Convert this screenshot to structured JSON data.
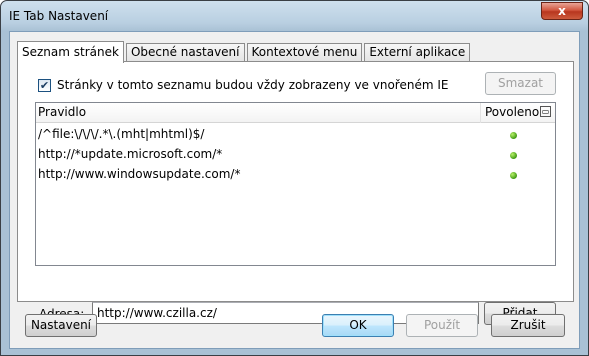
{
  "window": {
    "title": "IE Tab Nastavení",
    "close_glyph": "x"
  },
  "tabs": [
    {
      "label": "Seznam stránek",
      "active": true
    },
    {
      "label": "Obecné nastavení",
      "active": false
    },
    {
      "label": "Kontextové menu",
      "active": false
    },
    {
      "label": "Externí aplikace",
      "active": false
    }
  ],
  "sites_tab": {
    "checkbox": {
      "label": "Stránky v tomto seznamu budou vždy zobrazeny ve vnořeném IE",
      "checked": true,
      "check_glyph": "✔"
    },
    "delete_label": "Smazat",
    "list": {
      "columns": {
        "rule": "Pravidlo",
        "enabled": "Povoleno"
      },
      "column_picker_icon": "column-picker-icon",
      "rows": [
        {
          "pattern": "/^file:\\/\\/\\/.*\\.(mht|mhtml)$/",
          "enabled": true
        },
        {
          "pattern": "http://*update.microsoft.com/*",
          "enabled": true
        },
        {
          "pattern": "http://www.windowsupdate.com/*",
          "enabled": true
        }
      ]
    },
    "address": {
      "label": "Adresa:",
      "value": "http://www.czilla.cz/"
    },
    "add_label": "Přidat"
  },
  "footer": {
    "settings_label": "Nastavení",
    "ok_label": "OK",
    "apply_label": "Použít",
    "cancel_label": "Zrušit"
  },
  "colors": {
    "title_bg": "#b9cfe1",
    "close_red": "#c9452e",
    "enabled_dot": "#3f9b12",
    "dialog_bg": "#f0f0f0"
  }
}
